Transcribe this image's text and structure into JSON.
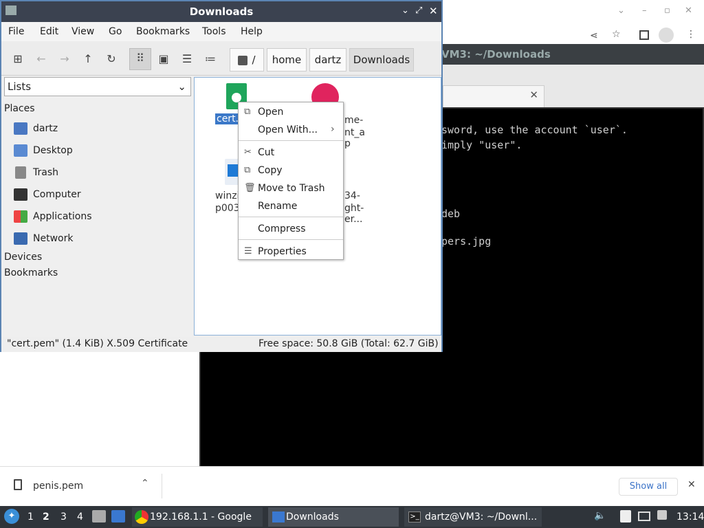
{
  "file_manager": {
    "title": "Downloads",
    "menu": [
      "File",
      "Edit",
      "View",
      "Go",
      "Bookmarks",
      "Tools",
      "Help"
    ],
    "breadcrumbs": [
      "/",
      "home",
      "dartz",
      "Downloads"
    ],
    "sidebar": {
      "dropdown": "Lists",
      "places_header": "Places",
      "places": [
        "dartz",
        "Desktop",
        "Trash",
        "Computer",
        "Applications",
        "Network"
      ],
      "devices_header": "Devices",
      "bookmarks_header": "Bookmarks"
    },
    "files": {
      "f1": "cert.p",
      "f2a": "me-",
      "f2b": "nt_a",
      "f2c": "p",
      "f3a": "winzi",
      "f3b": "p003",
      "f4a": "34-",
      "f4b": "ght-",
      "f4c": "er..."
    },
    "status_left": "\"cert.pem\" (1.4 KiB) X.509 Certificate",
    "status_right": "Free space: 50.8 GiB (Total: 62.7 GiB)"
  },
  "context_menu": {
    "open": "Open",
    "open_with": "Open With...",
    "cut": "Cut",
    "copy": "Copy",
    "trash": "Move to Trash",
    "rename": "Rename",
    "compress": "Compress",
    "properties": "Properties"
  },
  "terminal": {
    "title": "VM3: ~/Downloads",
    "line1": "sword, use the account `user`.",
    "line2": "imply \"user\".",
    "line3": "deb",
    "line4": "pers.jpg"
  },
  "download_bar": {
    "file": "penis.pem",
    "show_all": "Show all"
  },
  "taskbar": {
    "workspaces": [
      "1",
      "2",
      "3",
      "4"
    ],
    "chrome_task": "192.168.1.1 - Google ...",
    "fm_task": "Downloads",
    "term_task": "dartz@VM3: ~/Downl...",
    "clock": "13:14"
  }
}
